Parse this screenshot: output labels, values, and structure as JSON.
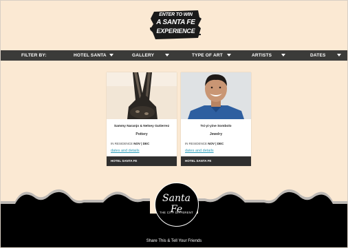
{
  "promo": {
    "line1": "ENTER TO WIN",
    "line2": "A SANTA FE",
    "line3": "EXPERIENCE"
  },
  "filter_bar": {
    "label": "FILTER BY:",
    "filters": [
      {
        "label": "HOTEL SANTA"
      },
      {
        "label": "GALLERY"
      },
      {
        "label": "TYPE OF ART"
      },
      {
        "label": "ARTISTS"
      },
      {
        "label": "DATES"
      }
    ]
  },
  "cards": [
    {
      "name": "Sammy Naranjo & Nelsey Gutierrez",
      "category": "Pottery",
      "residence_label": "IN RESIDENCE",
      "residence_dates": "NOV | DEC",
      "link": "dates and details",
      "venue": "HOTEL SANTA FE"
    },
    {
      "name": "Tsi-yi-yine Sombolo",
      "category": "Jewelry",
      "residence_label": "IN RESIDENCE",
      "residence_dates": "NOV | DEC",
      "link": "dates and details",
      "venue": "HOTEL SANTA FE"
    }
  ],
  "footer": {
    "logo_script": "Santa Fe",
    "logo_tagline": "THE CITY DIFFERENT",
    "share": "Share This & Tell Your Friends"
  },
  "colors": {
    "page_bg": "#fbe9d3",
    "bar_bg": "#3b3b39",
    "link": "#2a9bb8",
    "footer_bg": "#000000"
  }
}
